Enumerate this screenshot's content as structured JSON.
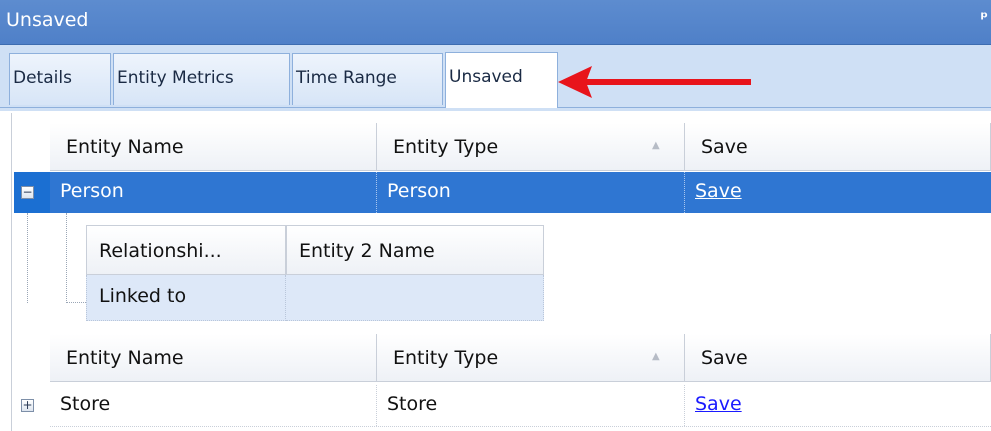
{
  "window": {
    "title": "Unsaved",
    "pin_icon": "pin-icon"
  },
  "tabs": [
    {
      "label": "Details"
    },
    {
      "label": "Entity Metrics"
    },
    {
      "label": "Time Range"
    },
    {
      "label": "Unsaved",
      "active": true
    }
  ],
  "annotation": {
    "arrow_color": "#e8141b"
  },
  "grid": {
    "columns": [
      "Entity Name",
      "Entity Type",
      "Save"
    ],
    "rows": [
      {
        "name": "Person",
        "type": "Person",
        "save": "Save",
        "expanded": true,
        "detail": {
          "columns": [
            "Relationshi...",
            "Entity 2 Name"
          ],
          "rows": [
            {
              "relationship": "Linked to",
              "entity2": ""
            }
          ]
        }
      },
      {
        "name": "Store",
        "type": "Store",
        "save": "Save",
        "expanded": false
      }
    ]
  },
  "colors": {
    "selection": "#2f76d2",
    "titlebar": "#4f80c8",
    "tabbar": "#cfe0f5"
  }
}
